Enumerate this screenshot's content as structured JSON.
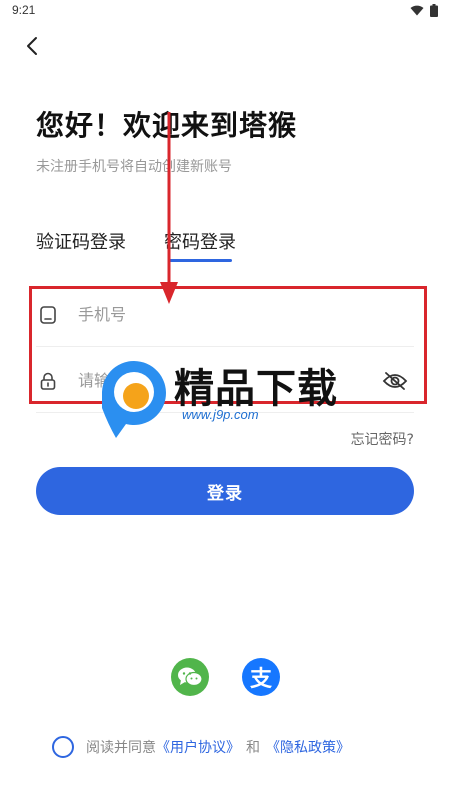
{
  "status_bar": {
    "time": "9:21"
  },
  "header": {
    "title": "您好！欢迎来到塔猴",
    "subtitle": "未注册手机号将自动创建新账号"
  },
  "tabs": [
    {
      "label": "验证码登录",
      "active": false
    },
    {
      "label": "密码登录",
      "active": true
    }
  ],
  "form": {
    "phone_placeholder": "手机号",
    "password_placeholder": "请输入密码",
    "forgot_password": "忘记密码?"
  },
  "login_button": "登录",
  "watermark": {
    "text": "精品下载",
    "url": "www.j9p.com"
  },
  "social": [
    {
      "icon": "wechat-icon"
    },
    {
      "icon": "alipay-icon",
      "glyph": "支"
    }
  ],
  "agreement": {
    "prefix": "阅读并同意",
    "user_agreement": "《用户协议》",
    "and": "和",
    "privacy_policy": "《隐私政策》"
  },
  "colors": {
    "accent": "#2e66e0",
    "annotation_red": "#d9262c",
    "wechat": "#51b54b",
    "alipay": "#1677ff"
  }
}
